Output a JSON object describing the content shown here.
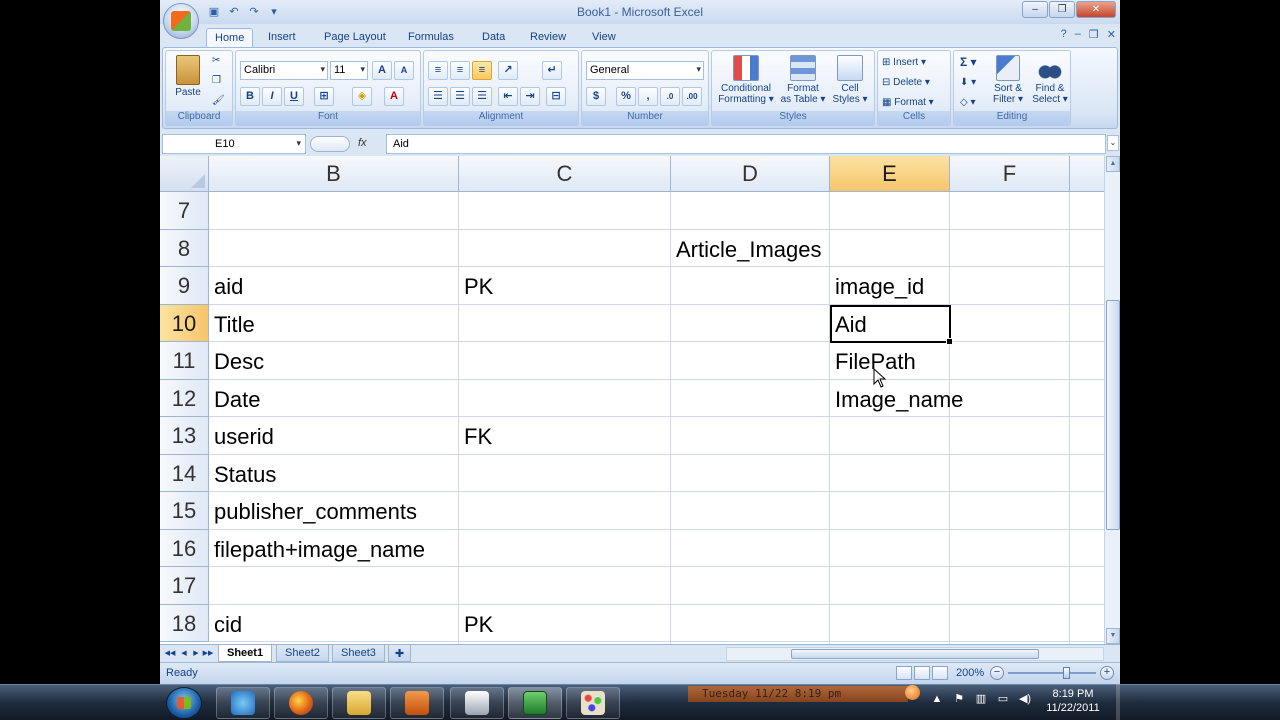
{
  "window": {
    "title": "Book1 - Microsoft Excel",
    "minimize_label": "–",
    "restore_label": "❐",
    "close_label": "✕"
  },
  "ribbon_tabs": [
    "Home",
    "Insert",
    "Page Layout",
    "Formulas",
    "Data",
    "Review",
    "View"
  ],
  "ribbon": {
    "clipboard": {
      "label": "Clipboard",
      "paste": "Paste"
    },
    "font": {
      "label": "Font",
      "font_name": "Calibri",
      "font_size": "11",
      "bold": "B",
      "italic": "I",
      "underline": "U",
      "grow": "A",
      "shrink": "A",
      "font_color": "A"
    },
    "alignment": {
      "label": "Alignment"
    },
    "number": {
      "label": "Number",
      "format": "General",
      "currency": "$",
      "percent": "%",
      "comma": ","
    },
    "styles": {
      "label": "Styles",
      "conditional_1": "Conditional",
      "conditional_2": "Formatting ▾",
      "table_1": "Format",
      "table_2": "as Table ▾",
      "cell_1": "Cell",
      "cell_2": "Styles ▾"
    },
    "cells": {
      "label": "Cells",
      "insert": "Insert ▾",
      "delete": "Delete ▾",
      "format": "Format ▾"
    },
    "editing": {
      "label": "Editing",
      "sigma": "Σ ▾",
      "sort_1": "Sort &",
      "sort_2": "Filter ▾",
      "find_1": "Find &",
      "find_2": "Select ▾"
    }
  },
  "formula_bar": {
    "name_box": "E10",
    "fx": "fx",
    "value": "Aid"
  },
  "columns": [
    {
      "name": "B",
      "selected": false
    },
    {
      "name": "C",
      "selected": false
    },
    {
      "name": "D",
      "selected": false
    },
    {
      "name": "E",
      "selected": true
    },
    {
      "name": "F",
      "selected": false
    }
  ],
  "rows": [
    {
      "num": "7",
      "B": "",
      "C": "",
      "D": "",
      "E": "",
      "selected": false
    },
    {
      "num": "8",
      "B": "",
      "C": "",
      "D": "Article_Images",
      "E": "",
      "selected": false
    },
    {
      "num": "9",
      "B": "aid",
      "C": "PK",
      "D": "",
      "E": "image_id",
      "selected": false
    },
    {
      "num": "10",
      "B": "Title",
      "C": "",
      "D": "",
      "E": "Aid",
      "selected": true
    },
    {
      "num": "11",
      "B": "Desc",
      "C": "",
      "D": "",
      "E": "FilePath",
      "selected": false
    },
    {
      "num": "12",
      "B": "Date",
      "C": "",
      "D": "",
      "E": "Image_name",
      "selected": false
    },
    {
      "num": "13",
      "B": "userid",
      "C": "FK",
      "D": "",
      "E": "",
      "selected": false
    },
    {
      "num": "14",
      "B": "Status",
      "C": "",
      "D": "",
      "E": "",
      "selected": false
    },
    {
      "num": "15",
      "B": "publisher_comments",
      "C": "",
      "D": "",
      "E": "",
      "selected": false
    },
    {
      "num": "16",
      "B": "filepath+image_name",
      "C": "",
      "D": "",
      "E": "",
      "selected": false
    },
    {
      "num": "17",
      "B": "",
      "C": "",
      "D": "",
      "E": "",
      "selected": false
    },
    {
      "num": "18",
      "B": "cid",
      "C": "PK",
      "D": "",
      "E": "",
      "selected": false
    }
  ],
  "sheets": [
    {
      "name": "Sheet1",
      "active": true
    },
    {
      "name": "Sheet2",
      "active": false
    },
    {
      "name": "Sheet3",
      "active": false
    }
  ],
  "status": {
    "text": "Ready",
    "zoom": "200%",
    "zoom_minus": "−",
    "zoom_plus": "+"
  },
  "taskbar": {
    "overlay_clock": "Tuesday 11/22   8:19 pm",
    "time": "8:19 PM",
    "date": "11/22/2011"
  },
  "colors": {
    "ribbon_blue": "#15428b",
    "selected_header": "#f7c56b",
    "grid_line": "#d0d7e5"
  }
}
